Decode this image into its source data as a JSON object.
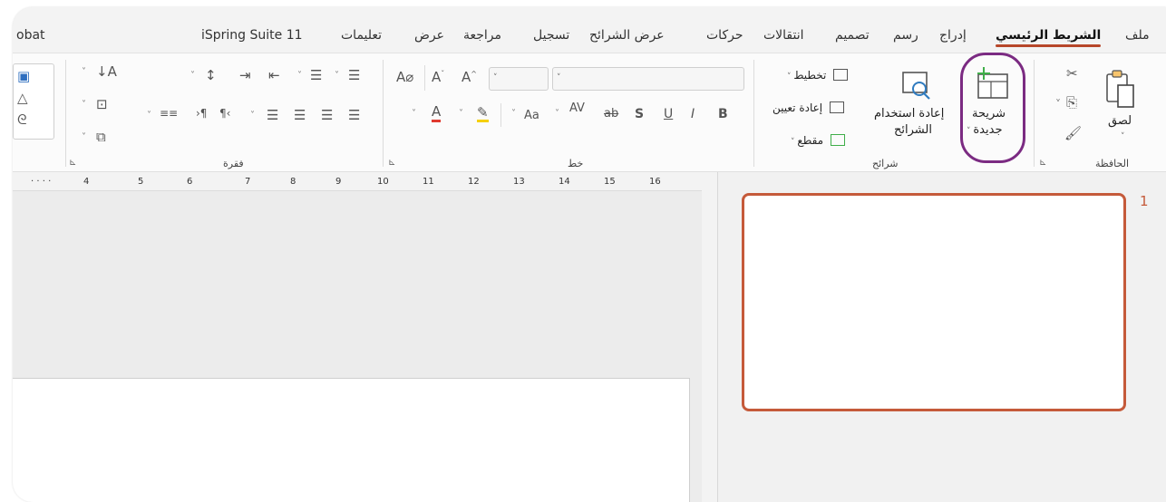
{
  "tabs": [
    "ملف",
    "الشريط الرئيسي",
    "إدراج",
    "رسم",
    "تصميم",
    "انتقالات",
    "حركات",
    "عرض الشرائح",
    "تسجيل",
    "مراجعة",
    "عرض",
    "تعليمات",
    "iSpring Suite 11",
    "obat"
  ],
  "active_tab": "الشريط الرئيسي",
  "ribbon": {
    "clipboard": {
      "group_label": "الحافظة",
      "paste_label": "لصق"
    },
    "slides": {
      "group_label": "شرائح",
      "new_slide_line1": "شريحة",
      "new_slide_line2": "جديدة",
      "reuse_line1": "إعادة استخدام",
      "reuse_line2": "الشرائح",
      "layout_label": "تخطيط",
      "reset_label": "إعادة تعيين",
      "section_label": "مقطع"
    },
    "font": {
      "group_label": "خط"
    },
    "paragraph": {
      "group_label": "فقرة"
    }
  },
  "ruler_ticks": [
    "16",
    "15",
    "14",
    "13",
    "12",
    "11",
    "10",
    "9",
    "8",
    "7",
    "6",
    "5",
    "4"
  ],
  "thumbnail": {
    "number": "1"
  },
  "colors": {
    "accent": "#b7472a",
    "highlight": "#7b2b82",
    "thumb_border": "#c55a3a"
  }
}
